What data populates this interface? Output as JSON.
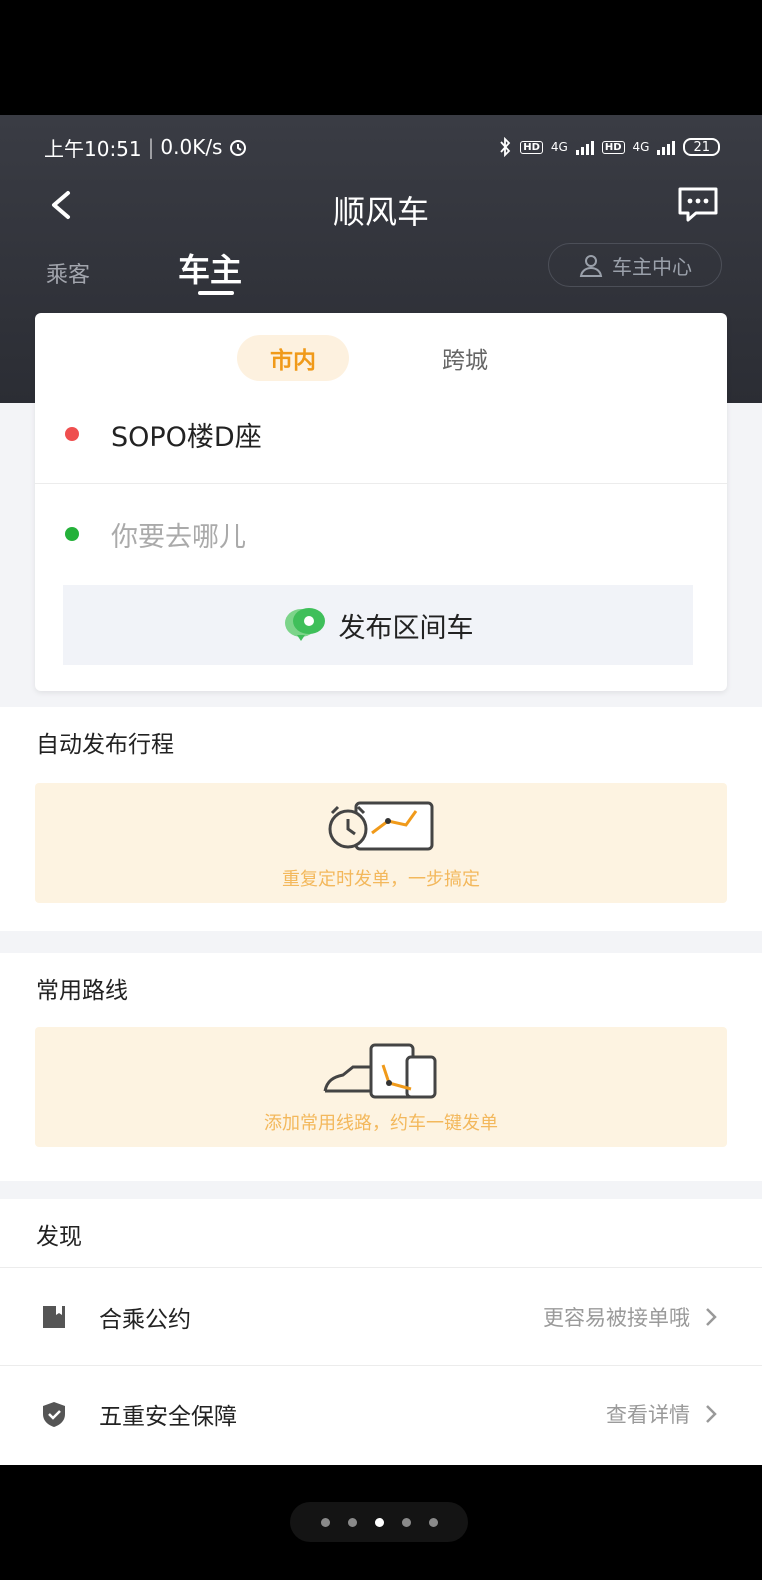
{
  "status_bar": {
    "time": "上午10:51",
    "speed": "0.0K/s",
    "net1": "4G",
    "net2": "4G",
    "hd": "HD",
    "battery": "21"
  },
  "nav": {
    "title": "顺风车",
    "back_icon": "back-arrow-icon",
    "message_icon": "message-icon"
  },
  "role_tabs": {
    "passenger": "乘客",
    "driver": "车主",
    "driver_center": "车主中心"
  },
  "card": {
    "mode_tabs": [
      "市内",
      "跨城"
    ],
    "from": "SOPO楼D座",
    "to_placeholder": "你要去哪儿",
    "publish_label": "发布区间车"
  },
  "auto_publish": {
    "title": "自动发布行程",
    "promo_text": "重复定时发单，一步搞定"
  },
  "common_routes": {
    "title": "常用路线",
    "promo_text": "添加常用线路，约车一键发单"
  },
  "discover": {
    "title": "发现",
    "items": [
      {
        "label": "合乘公约",
        "hint": "更容易被接单哦",
        "icon": "book-icon"
      },
      {
        "label": "五重安全保障",
        "hint": "查看详情",
        "icon": "shield-icon"
      }
    ]
  },
  "pager": {
    "count": 5,
    "active_index": 2
  },
  "colors": {
    "accent": "#f09a1a",
    "origin_dot": "#ef4f4f",
    "destination_dot": "#24b13a",
    "header_bg": "#2f3138"
  }
}
